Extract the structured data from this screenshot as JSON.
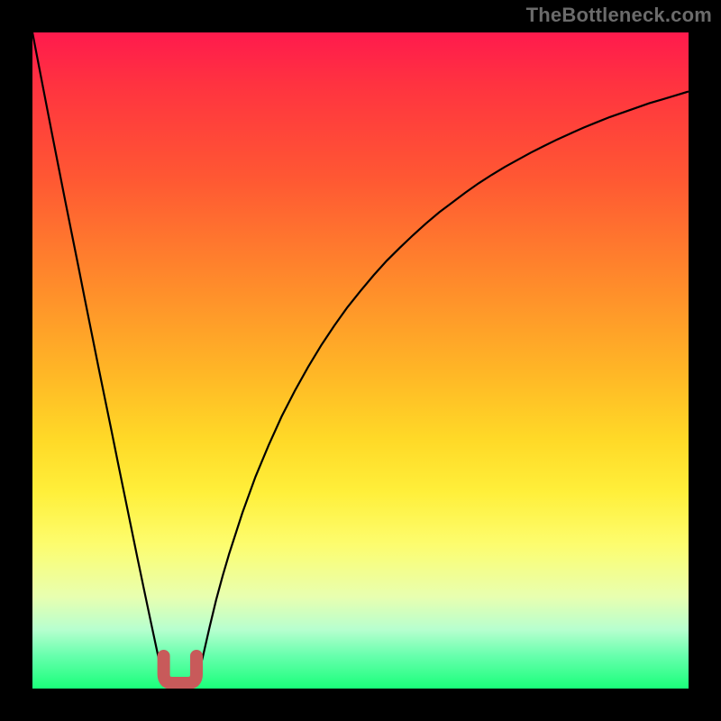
{
  "watermark": "TheBottleneck.com",
  "colors": {
    "frame": "#000000",
    "curve_stroke": "#000000",
    "marker": "#c85a5a",
    "gradient_top": "#ff1a4d",
    "gradient_bottom": "#1aff7a"
  },
  "chart_data": {
    "type": "line",
    "title": "",
    "xlabel": "",
    "ylabel": "",
    "xlim": [
      0,
      100
    ],
    "ylim": [
      0,
      100
    ],
    "x": [
      0,
      1,
      2,
      3,
      4,
      5,
      6,
      7,
      8,
      9,
      10,
      11,
      12,
      13,
      14,
      15,
      16,
      17,
      18,
      19,
      20,
      21,
      22,
      23,
      24,
      25,
      26,
      27,
      28,
      29,
      30,
      32,
      34,
      36,
      38,
      40,
      42,
      44,
      46,
      48,
      50,
      52,
      54,
      56,
      58,
      60,
      62,
      64,
      66,
      68,
      70,
      72,
      74,
      76,
      78,
      80,
      82,
      84,
      86,
      88,
      90,
      92,
      94,
      96,
      98,
      100
    ],
    "values": [
      100,
      94.8,
      89.6,
      84.5,
      79.4,
      74.3,
      69.3,
      64.3,
      59.3,
      54.3,
      49.3,
      44.4,
      39.5,
      34.6,
      29.7,
      24.8,
      19.9,
      15.1,
      10.4,
      5.7,
      1.0,
      0.0,
      0.0,
      0.0,
      0.0,
      1.0,
      5.0,
      9.4,
      13.5,
      17.2,
      20.6,
      26.8,
      32.3,
      37.1,
      41.5,
      45.4,
      49.0,
      52.3,
      55.3,
      58.1,
      60.6,
      63.0,
      65.2,
      67.2,
      69.1,
      70.9,
      72.6,
      74.1,
      75.6,
      77.0,
      78.3,
      79.5,
      80.6,
      81.7,
      82.7,
      83.7,
      84.6,
      85.5,
      86.3,
      87.1,
      87.8,
      88.5,
      89.2,
      89.8,
      90.4,
      91.0
    ],
    "marker_band": {
      "x_start": 20,
      "x_end": 25,
      "y": 0
    }
  }
}
